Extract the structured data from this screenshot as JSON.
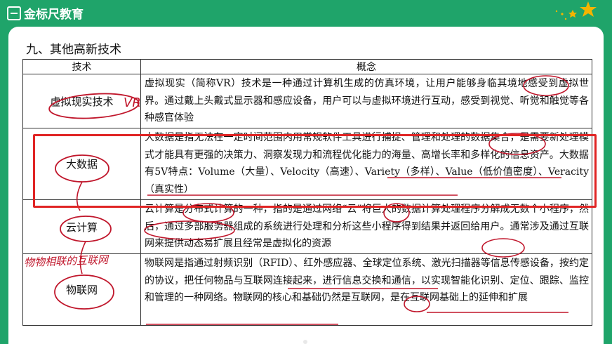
{
  "header": {
    "brand": "金标尺教育",
    "colors": {
      "bar": "#1fa46a",
      "star": "#f5b400"
    }
  },
  "section_title": "九、其他高新技术",
  "table": {
    "headers": {
      "tech": "技术",
      "concept": "概念"
    },
    "rows": [
      {
        "tech": "虚拟现实技术",
        "desc": "虚拟现实（简称VR）技术是一种通过计算机生成的仿真环境，让用户能够身临其境地感受到虚拟世界。通过戴上头戴式显示器和感应设备，用户可以与虚拟环境进行互动，感受到视觉、听觉和触觉等各种感官体验"
      },
      {
        "tech": "大数据",
        "desc": "大数据是指无法在一定时间范围内用常规软件工具进行捕捉、管理和处理的数据集合，是需要新处理模式才能具有更强的决策力、洞察发现力和流程优化能力的海量、高增长率和多样化的信息资产。大数据有5V特点：Volume（大量）、Velocity（高速）、Variety（多样）、Value（低价值密度）、Veracity（真实性）"
      },
      {
        "tech": "云计算",
        "desc": "云计算是分布式计算的一种，指的是通过网络“云”将巨大的数据计算处理程序分解成无数个小程序，然后，通过多部服务器组成的系统进行处理和分析这些小程序得到结果并返回给用户。通常涉及通过互联网来提供动态易扩展且经常是虚拟化的资源"
      },
      {
        "tech": "物联网",
        "desc": "物联网是指通过射频识别（RFID）、红外感应器、全球定位系统、激光扫描器等信息传感设备，按约定的协议，把任何物品与互联网连接起来，进行信息交换和通信，以实现智能化识别、定位、跟踪、监控和管理的一种网络。物联网的核心和基础仍然是互联网，是在互联网基础上的延伸和扩展"
      }
    ]
  },
  "handwriting": {
    "vr_note": "VR",
    "iot_note": "物物相联的互联网",
    "ink_color": "#c0162b",
    "highlight_box_color": "#e02424"
  }
}
